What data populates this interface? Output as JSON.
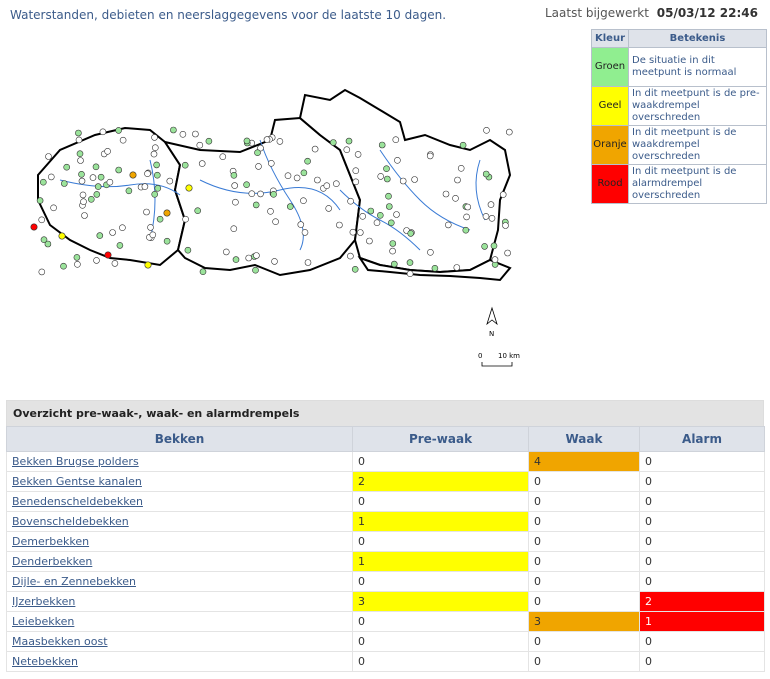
{
  "header": {
    "intro": "Waterstanden, debieten en neerslaggegevens voor de laatste 10 dagen.",
    "updated_label": "Laatst bijgewerkt",
    "updated_value": "05/03/12 22:46"
  },
  "legend": {
    "col_color": "Kleur",
    "col_meaning": "Betekenis",
    "rows": [
      {
        "name": "Groen",
        "color": "#90ee90",
        "desc": "De situatie in dit meetpunt is normaal"
      },
      {
        "name": "Geel",
        "color": "#ffff00",
        "desc": "In dit meetpunt is de pre-waakdrempel overschreden"
      },
      {
        "name": "Oranje",
        "color": "#f0a500",
        "desc": "In dit meetpunt is de waakdrempel overschreden"
      },
      {
        "name": "Rood",
        "color": "#ff0000",
        "desc": "In dit meetpunt is de alarmdrempel overschreden"
      }
    ]
  },
  "map": {
    "north_label": "N",
    "scale_start": "0",
    "scale_end": "10 km"
  },
  "overview": {
    "title": "Overzicht pre-waak-, waak- en alarmdrempels",
    "headers": [
      "Bekken",
      "Pre-waak",
      "Waak",
      "Alarm"
    ],
    "rows": [
      {
        "name": "Bekken Brugse polders",
        "prewaak": "0",
        "waak": "4",
        "alarm": "0"
      },
      {
        "name": "Bekken Gentse kanalen",
        "prewaak": "2",
        "waak": "0",
        "alarm": "0"
      },
      {
        "name": "Benedenscheldebekken",
        "prewaak": "0",
        "waak": "0",
        "alarm": "0"
      },
      {
        "name": "Bovenscheldebekken",
        "prewaak": "1",
        "waak": "0",
        "alarm": "0"
      },
      {
        "name": "Demerbekken",
        "prewaak": "0",
        "waak": "0",
        "alarm": "0"
      },
      {
        "name": "Denderbekken",
        "prewaak": "1",
        "waak": "0",
        "alarm": "0"
      },
      {
        "name": "Dijle- en Zennebekken",
        "prewaak": "0",
        "waak": "0",
        "alarm": "0"
      },
      {
        "name": "IJzerbekken",
        "prewaak": "3",
        "waak": "0",
        "alarm": "2"
      },
      {
        "name": "Leiebekken",
        "prewaak": "0",
        "waak": "3",
        "alarm": "1"
      },
      {
        "name": "Maasbekken oost",
        "prewaak": "0",
        "waak": "0",
        "alarm": "0"
      },
      {
        "name": "Netebekken",
        "prewaak": "0",
        "waak": "0",
        "alarm": "0"
      }
    ]
  }
}
